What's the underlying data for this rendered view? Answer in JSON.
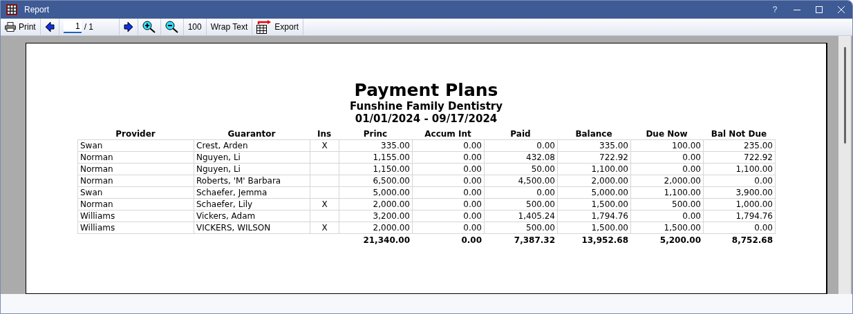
{
  "window": {
    "title": "Report",
    "help": "?"
  },
  "toolbar": {
    "print": "Print",
    "page": {
      "value": "1",
      "total": "/ 1"
    },
    "zoom_level": "100",
    "wrap_text": "Wrap Text",
    "export": "Export"
  },
  "report": {
    "title": "Payment Plans",
    "subtitle": "Funshine Family Dentistry",
    "date_range": "01/01/2024 - 09/17/2024",
    "columns": [
      "Provider",
      "Guarantor",
      "Ins",
      "Princ",
      "Accum Int",
      "Paid",
      "Balance",
      "Due Now",
      "Bal Not Due"
    ],
    "rows": [
      {
        "provider": "Swan",
        "guarantor": "Crest, Arden",
        "ins": "X",
        "amounts": [
          "335.00",
          "0.00",
          "0.00",
          "335.00",
          "100.00",
          "235.00"
        ]
      },
      {
        "provider": "Norman",
        "guarantor": "Nguyen, Li",
        "amounts": [
          "1,155.00",
          "0.00",
          "432.08",
          "722.92",
          "0.00",
          "722.92"
        ]
      },
      {
        "provider": "Norman",
        "guarantor": "Nguyen, Li",
        "amounts": [
          "1,150.00",
          "0.00",
          "50.00",
          "1,100.00",
          "0.00",
          "1,100.00"
        ]
      },
      {
        "provider": "Norman",
        "guarantor": "Roberts, 'M' Barbara",
        "amounts": [
          "6,500.00",
          "0.00",
          "4,500.00",
          "2,000.00",
          "2,000.00",
          "0.00"
        ]
      },
      {
        "provider": "Swan",
        "guarantor": "Schaefer, Jemma",
        "amounts": [
          "5,000.00",
          "0.00",
          "0.00",
          "5,000.00",
          "1,100.00",
          "3,900.00"
        ]
      },
      {
        "provider": "Norman",
        "guarantor": "Schaefer, Lily",
        "ins": "X",
        "amounts": [
          "2,000.00",
          "0.00",
          "500.00",
          "1,500.00",
          "500.00",
          "1,000.00"
        ]
      },
      {
        "provider": "Williams",
        "guarantor": "Vickers, Adam",
        "amounts": [
          "3,200.00",
          "0.00",
          "1,405.24",
          "1,794.76",
          "0.00",
          "1,794.76"
        ]
      },
      {
        "provider": "Williams",
        "guarantor": "VICKERS, WILSON",
        "ins": "X",
        "amounts": [
          "2,000.00",
          "0.00",
          "500.00",
          "1,500.00",
          "1,500.00",
          "0.00"
        ]
      }
    ],
    "totals": [
      "21,340.00",
      "0.00",
      "7,387.32",
      "13,952.68",
      "5,200.00",
      "8,752.68"
    ]
  }
}
